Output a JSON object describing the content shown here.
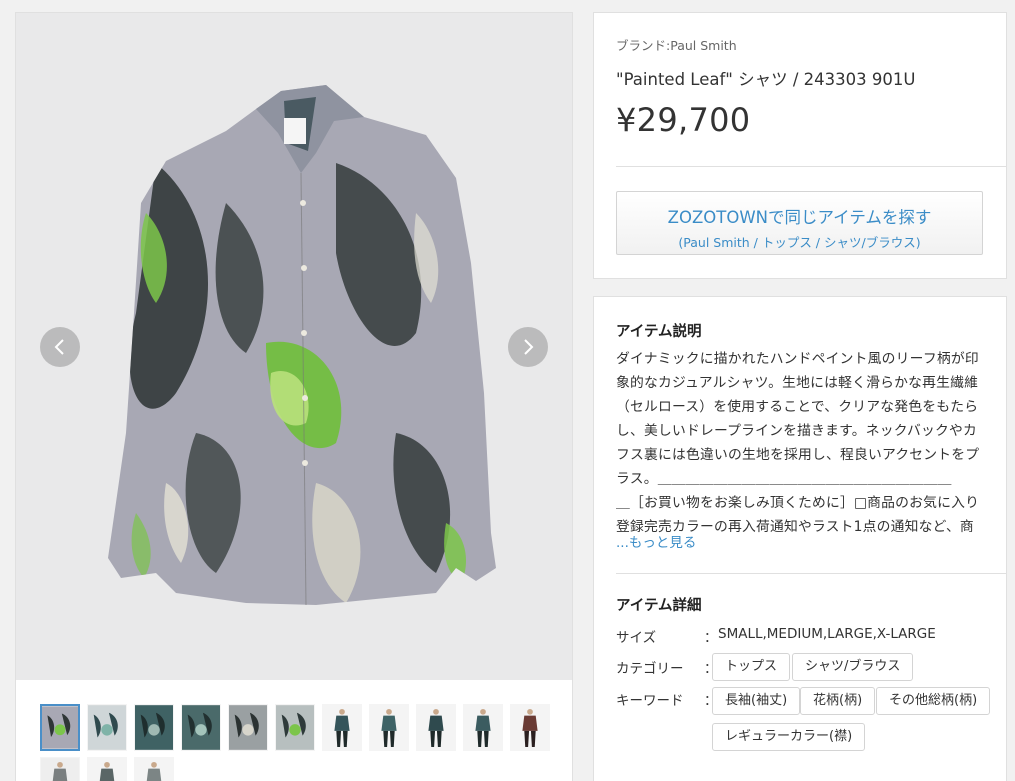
{
  "product": {
    "brand_label": "ブランド:Paul Smith",
    "title": "\"Painted Leaf\" シャツ / 243303 901U",
    "price": "¥29,700"
  },
  "zozotown_button": {
    "main": "ZOZOTOWNで同じアイテムを探す",
    "sub": "(Paul Smith / トップス / シャツ/ブラウス)"
  },
  "description": {
    "heading": "アイテム説明",
    "lines": [
      "ダイナミックに描かれたハンドペイント風のリーフ柄が印",
      "象的なカジュアルシャツ。生地には軽く滑らかな再生繊維",
      "（セルロース）を使用することで、クリアな発色をもたら",
      "し、美しいドレープラインを描きます。ネックバックやカ",
      "フス裏には色違いの生地を採用し、程良いアクセントをプ",
      "ラス。＿＿＿＿＿＿＿＿＿＿＿＿＿＿＿＿＿＿＿＿＿",
      "＿［お買い物をお楽しみ頂くために］□商品のお気に入り",
      "登録完売カラーの再入荷通知やラスト1点の通知など、商"
    ],
    "more_link": "...もっと見る"
  },
  "details": {
    "heading": "アイテム詳細",
    "size_label": "サイズ",
    "colon": "：",
    "size_value": "SMALL,MEDIUM,LARGE,X-LARGE",
    "category_label": "カテゴリー",
    "categories": [
      "トップス",
      "シャツ/ブラウス"
    ],
    "keyword_label": "キーワード",
    "keywords": [
      "長袖(袖丈)",
      "花柄(柄)",
      "その他総柄(柄)",
      "レギュラーカラー(襟)"
    ]
  },
  "gallery": {
    "thumbnail_count": 14,
    "active_index": 0
  },
  "icons": {
    "prev": "chevron-left-icon",
    "next": "chevron-right-icon"
  },
  "colors": {
    "link": "#3a8cc7",
    "active_border": "#4a8fc8"
  }
}
